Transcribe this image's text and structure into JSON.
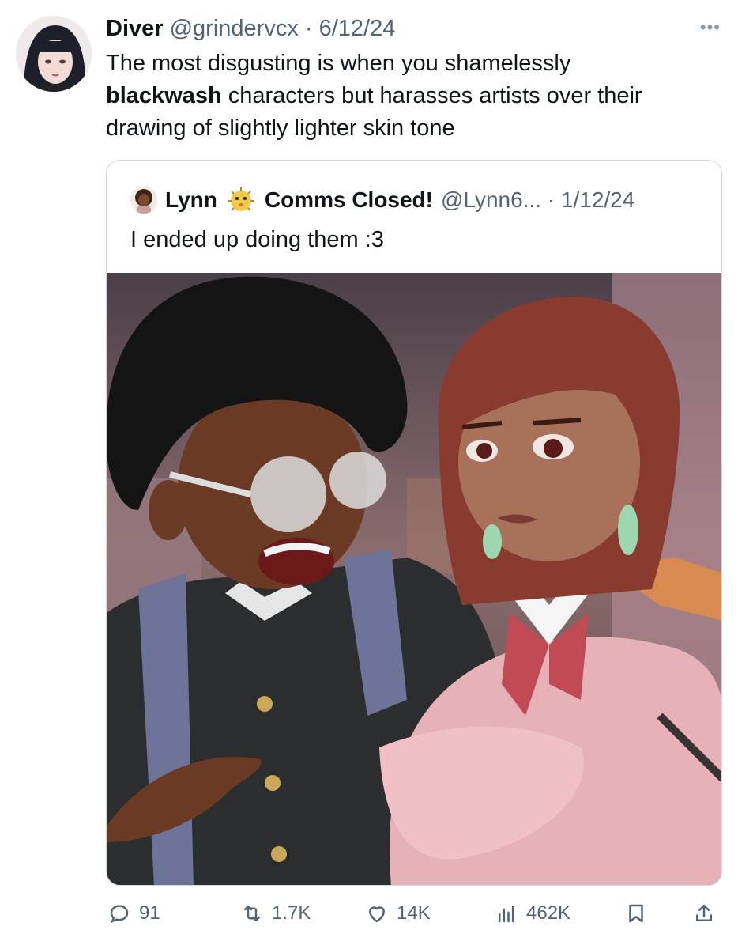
{
  "tweet": {
    "author_name": "Diver",
    "meta": "@grindervcx · 6/12/24",
    "text_before": "The most disgusting is when you shamelessly",
    "text_bold": "blackwash",
    "text_after": " characters but harasses artists over their drawing of slightly lighter skin tone",
    "more_icon": "more-icon",
    "more_glyph": "•••"
  },
  "quote": {
    "author_name": "Lynn",
    "status_label": "Comms Closed!",
    "meta": "@Lynn6... · 1/12/24",
    "text": "I ended up doing them :3",
    "image_alt": "illustration-two-students"
  },
  "actions": {
    "replies": "91",
    "retweets": "1.7K",
    "likes": "14K",
    "views": "462K"
  },
  "colors": {
    "text": "#0f1419",
    "muted": "#536471",
    "border": "#cfd9de"
  }
}
